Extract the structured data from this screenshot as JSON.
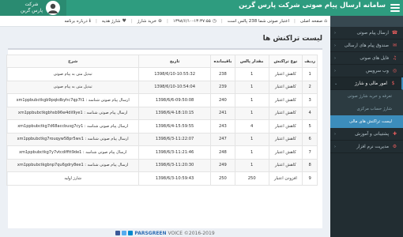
{
  "header": {
    "title": "سامانه ارسال پیام صوتی شرکت پارس گرین",
    "user_company": "شرکت",
    "user_name": "پارس گرین",
    "brand_color": "#2e9c7f"
  },
  "infobar": {
    "home_label": "صفحه اصلی",
    "balance_label": "اعتبار صوتی شما 238 پالس است",
    "date_time": "۱۳۹۸/۶/۱۰-۱۳:۳۷:۵۵",
    "buy_charge_label": "خرید شارژ",
    "gift_charge_label": "شارژ هدیه",
    "about_label": "درباره برنامه"
  },
  "sidebar": {
    "items": [
      {
        "label": "ارسال پیام صوتی",
        "icon": "phone-icon"
      },
      {
        "label": "صندوق پیام های ارسالی",
        "icon": "inbox-icon"
      },
      {
        "label": "فایل های صوتی",
        "icon": "audio-file-icon"
      },
      {
        "label": "وب سرویس",
        "icon": "globe-icon"
      },
      {
        "label": "امور مالی و شارژ",
        "icon": "money-icon",
        "active": true
      }
    ],
    "sub_items": [
      {
        "label": "تعرفه و خرید شارژ صوتی"
      },
      {
        "label": "شارژ حساب مرکزی"
      },
      {
        "label": "لیست تراکنش های مالی",
        "selected": true
      }
    ],
    "bottom_items": [
      {
        "label": "پشتیبانی و آموزش",
        "icon": "support-icon"
      },
      {
        "label": "مدیریت نرم افزار",
        "icon": "settings-icon"
      }
    ]
  },
  "main": {
    "page_title": "لیست تراکنش ها",
    "table": {
      "columns": [
        "ردیف",
        "نوع تراکنش",
        "مقدار پالس",
        "باقیمانده",
        "تاریخ",
        "شرح"
      ],
      "rows": [
        [
          "1",
          "کاهش اعتبار",
          "1",
          "238",
          "1398/6/10-10:55:32",
          "تبدیل متن به پیام صوتی"
        ],
        [
          "2",
          "کاهش اعتبار",
          "1",
          "239",
          "1398/6/10-10:54:04",
          "تبدیل متن به پیام صوتی"
        ],
        [
          "3",
          "کاهش اعتبار",
          "1",
          "240",
          "1398/6/6-09:50:08",
          "ارسال پیام صوتی شناسه : xm1ppbubctkgb9pqkdbyhc7qp7t1"
        ],
        [
          "4",
          "کاهش اعتبار",
          "1",
          "241",
          "1398/6/4-18:10:15",
          "ارسال پیام صوتی شناسه : xm1ppbubctkgbhsb96w4dii9ye1"
        ],
        [
          "5",
          "کاهش اعتبار",
          "4",
          "243",
          "1398/6/4-15:59:55",
          "ارسال پیام صوتی شناسه : xm1ppbubctkg7d68accbusg7cy1"
        ],
        [
          "6",
          "کاهش اعتبار",
          "1",
          "247",
          "1398/6/3-11:22:07",
          "ارسال پیام صوتی شناسه : xm1ppbubctkg7rouqyw58pr5wv1"
        ],
        [
          "7",
          "کاهش اعتبار",
          "1",
          "248",
          "1398/6/3-11:21:46",
          "ارسال پیام صوتی شناسه : xm1ppbubctkg7y7vtcdifftt9de1"
        ],
        [
          "8",
          "کاهش اعتبار",
          "1",
          "249",
          "1398/6/3-11:20:30",
          "ارسال پیام صوتی شناسه : xm1ppbubctkgbnp7qu6gdry8ee1"
        ],
        [
          "9",
          "افزودن اعتبار",
          "250",
          "250",
          "1398/6/3-10:59:43",
          "شارژ اولیه"
        ]
      ]
    }
  },
  "footer": {
    "brand": "PARSGREEN",
    "text": "VOICE ©2016-2019"
  }
}
